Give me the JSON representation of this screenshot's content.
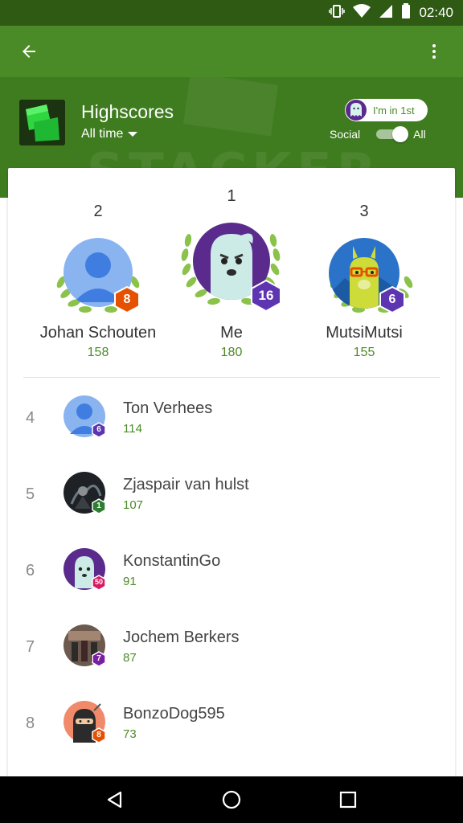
{
  "status_bar": {
    "time": "02:40"
  },
  "hero": {
    "title": "Highscores",
    "period": "All time",
    "watermark": "STACKER",
    "rank_chip_label": "I'm in 1st",
    "scope_left": "Social",
    "scope_right": "All"
  },
  "podium": [
    {
      "rank": "2",
      "name": "Johan Schouten",
      "score": "158",
      "level": "8",
      "level_color": "#e65100",
      "avatar": "default-person-icon"
    },
    {
      "rank": "1",
      "name": "Me",
      "score": "180",
      "level": "16",
      "level_color": "#5e35b1",
      "avatar": "ghost-avatar"
    },
    {
      "rank": "3",
      "name": "MutsiMutsi",
      "score": "155",
      "level": "6",
      "level_color": "#5e35b1",
      "avatar": "llama-avatar"
    }
  ],
  "leaderboard": [
    {
      "rank": "4",
      "name": "Ton Verhees",
      "score": "114",
      "level": "6",
      "level_color": "#5e35b1",
      "avatar": "default-person-icon"
    },
    {
      "rank": "5",
      "name": "Zjaspair van hulst",
      "score": "107",
      "level": "1",
      "level_color": "#2e7d32",
      "avatar": "photo-avatar-dark"
    },
    {
      "rank": "6",
      "name": "KonstantinGo",
      "score": "91",
      "level": "50",
      "level_color": "#d81b60",
      "avatar": "ghost-avatar"
    },
    {
      "rank": "7",
      "name": "Jochem Berkers",
      "score": "87",
      "level": "7",
      "level_color": "#7b1fa2",
      "avatar": "photo-avatar-street"
    },
    {
      "rank": "8",
      "name": "BonzoDog595",
      "score": "73",
      "level": "8",
      "level_color": "#e65100",
      "avatar": "ninja-avatar"
    }
  ],
  "colors": {
    "primary": "#4b8b27",
    "primary_dark": "#2f5a14",
    "score_text": "#4b8b27",
    "laurel": "#8bc34a"
  }
}
